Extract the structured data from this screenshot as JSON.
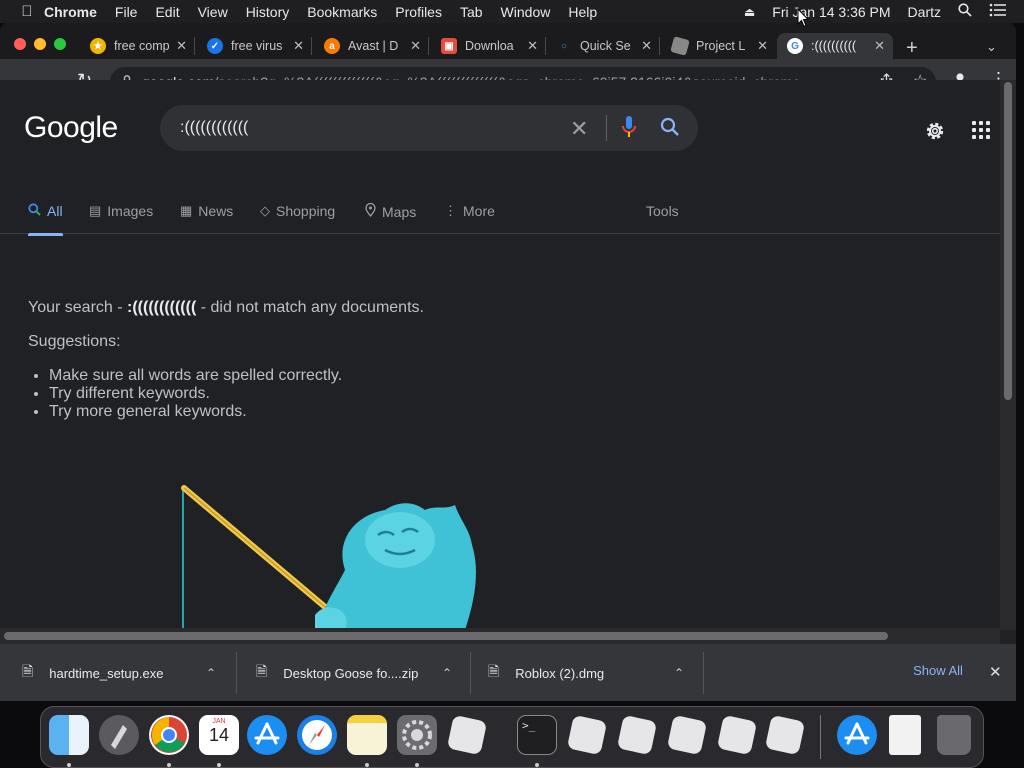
{
  "menubar": {
    "app": "Chrome",
    "items": [
      "File",
      "Edit",
      "View",
      "History",
      "Bookmarks",
      "Profiles",
      "Tab",
      "Window",
      "Help"
    ],
    "clock": "Fri Jan 14  3:36 PM",
    "user": "Dartz"
  },
  "tabs": [
    {
      "title": "free comp",
      "favicon": "star-icon",
      "color": "#f2b600"
    },
    {
      "title": "free virus",
      "favicon": "shield-check-icon",
      "color": "#1a73e8"
    },
    {
      "title": "Avast | D",
      "favicon": "avast-icon",
      "color": "#ff7800"
    },
    {
      "title": "Downloa",
      "favicon": "store-icon",
      "color": "#e84a3c"
    },
    {
      "title": "Quick Se",
      "favicon": "search-icon",
      "color": "#3c8dbc"
    },
    {
      "title": "Project L",
      "favicon": "roblox-icon",
      "color": "#888888"
    },
    {
      "title": ":((((((((((",
      "favicon": "google-icon",
      "color": "#ffffff",
      "active": true
    }
  ],
  "omnibox": {
    "domain": "google.com",
    "path": "/search?q=%3A(((((((((((((&oq=%3A(((((((((((((&aqs=chrome..69i57.2166j0j4&sourceid=chrome..."
  },
  "google": {
    "logo": "Google",
    "query": ":((((((((((((",
    "tabs": [
      "All",
      "Images",
      "News",
      "Shopping",
      "Maps",
      "More"
    ],
    "tools": "Tools",
    "no_results": {
      "prefix": "Your search - ",
      "query": ":((((((((((((",
      "suffix": " - did not match any documents."
    },
    "suggestions_label": "Suggestions:",
    "suggestions": [
      "Make sure all words are spelled correctly.",
      "Try different keywords.",
      "Try more general keywords."
    ]
  },
  "downloads": {
    "items": [
      "hardtime_setup.exe",
      "Desktop Goose fo....zip",
      "Roblox (2).dmg"
    ],
    "show_all": "Show All"
  },
  "dock": {
    "calendar_month": "JAN",
    "calendar_day": "14",
    "apps": [
      "finder",
      "launchpad",
      "chrome",
      "calendar",
      "app-store",
      "safari",
      "notes",
      "system-preferences",
      "roblox",
      "terminal",
      "roblox",
      "roblox",
      "roblox",
      "roblox",
      "roblox",
      "app-store",
      "document",
      "trash"
    ]
  },
  "colors": {
    "accent": "#8ab4f8",
    "page_bg": "#202124",
    "toolbar_bg": "#35363a"
  }
}
